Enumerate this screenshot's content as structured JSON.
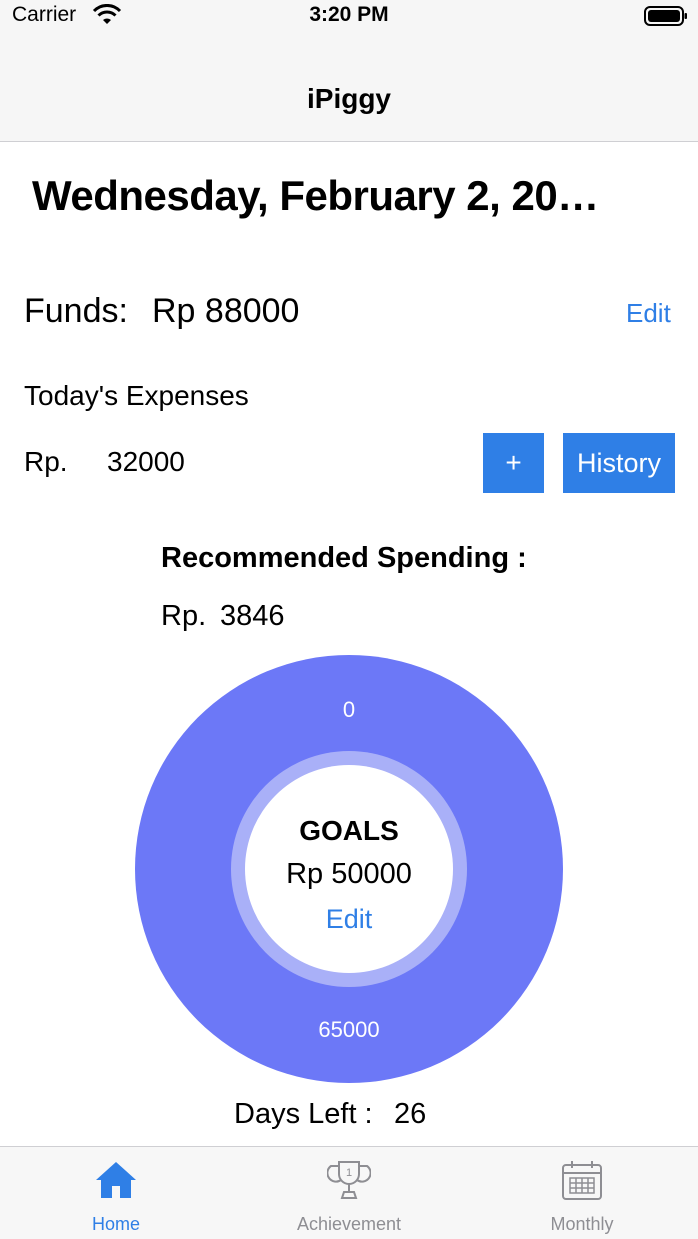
{
  "status_bar": {
    "carrier": "Carrier",
    "time": "3:20 PM"
  },
  "nav": {
    "title": "iPiggy"
  },
  "date_title": "Wednesday, February 2, 20…",
  "funds": {
    "label": "Funds:",
    "value": "Rp 88000",
    "edit_label": "Edit"
  },
  "expenses": {
    "title": "Today's Expenses",
    "currency_label": "Rp.",
    "value": "32000",
    "add_label": "+",
    "history_label": "History"
  },
  "recommended": {
    "title": "Recommended Spending :",
    "currency_label": "Rp.",
    "value": "3846"
  },
  "goals_chart": {
    "top_label": "0",
    "bottom_label": "65000",
    "title": "GOALS",
    "value": "Rp 50000",
    "edit_label": "Edit"
  },
  "days_left": {
    "label": "Days Left :",
    "value": "26"
  },
  "tabs": [
    {
      "label": "Home",
      "icon": "house-icon",
      "active": true
    },
    {
      "label": "Achievement",
      "icon": "trophy-icon",
      "active": false
    },
    {
      "label": "Monthly",
      "icon": "calendar-icon",
      "active": false
    }
  ],
  "colors": {
    "accent": "#2f7fe6",
    "donut": "#6c78f7",
    "donut_ring": "#a9b0f8",
    "tab_inactive": "#8e8e93"
  }
}
